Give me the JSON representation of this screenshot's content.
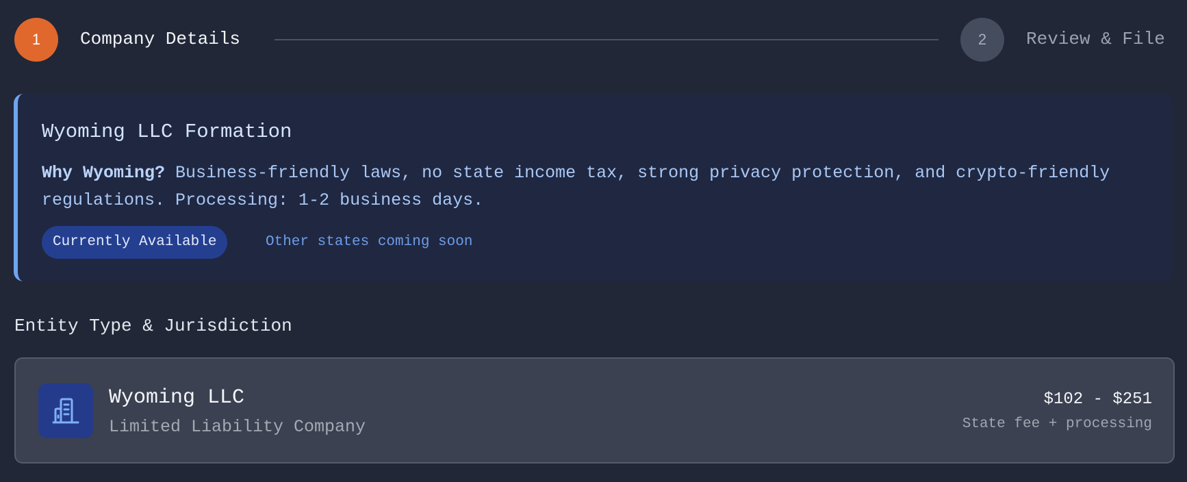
{
  "stepper": {
    "steps": [
      {
        "number": "1",
        "label": "Company Details",
        "state": "active"
      },
      {
        "number": "2",
        "label": "Review & File",
        "state": "inactive"
      }
    ]
  },
  "info": {
    "title": "Wyoming LLC Formation",
    "why_label": "Why Wyoming?",
    "why_text": " Business-friendly laws, no state income tax, strong privacy protection, and crypto-friendly regulations. Processing: 1-2 business days.",
    "badge": "Currently Available",
    "note": "Other states coming soon"
  },
  "entity_section": {
    "heading": "Entity Type & Jurisdiction",
    "option": {
      "icon": "building-icon",
      "name": "Wyoming LLC",
      "subtitle": "Limited Liability Company",
      "price": "$102 - $251",
      "price_note": "State fee + processing"
    }
  },
  "colors": {
    "background": "#212737",
    "accent_orange": "#e0682d",
    "info_border": "#6ea4f0",
    "badge_bg": "#243f8f",
    "card_bg": "#3b4150"
  }
}
